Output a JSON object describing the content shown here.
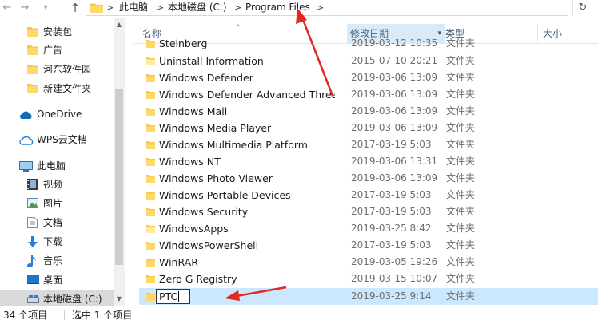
{
  "address": {
    "crumbs": [
      "此电脑",
      "本地磁盘 (C:)",
      "Program Files"
    ],
    "separators": [
      ">",
      ">",
      ">"
    ]
  },
  "nav": {
    "quick_access": [
      {
        "label": "安装包"
      },
      {
        "label": "广告"
      },
      {
        "label": "河东软件园"
      },
      {
        "label": "新建文件夹"
      }
    ],
    "onedrive": "OneDrive",
    "wps": "WPS云文档",
    "this_pc": "此电脑",
    "pc_items": [
      {
        "label": "视频",
        "icon": "video-icon"
      },
      {
        "label": "图片",
        "icon": "pictures-icon"
      },
      {
        "label": "文档",
        "icon": "documents-icon"
      },
      {
        "label": "下载",
        "icon": "download-icon"
      },
      {
        "label": "音乐",
        "icon": "music-icon"
      },
      {
        "label": "桌面",
        "icon": "desktop-icon"
      },
      {
        "label": "本地磁盘 (C:)",
        "icon": "drive-icon"
      }
    ]
  },
  "columns": {
    "name": "名称",
    "date": "修改日期",
    "type": "类型",
    "size": "大小"
  },
  "files": [
    {
      "name": "Steinberg",
      "date": "2019-03-12 10:35",
      "type": "文件夹"
    },
    {
      "name": "Uninstall Information",
      "date": "2015-07-10 20:21",
      "type": "文件夹"
    },
    {
      "name": "Windows Defender",
      "date": "2019-03-06 13:09",
      "type": "文件夹"
    },
    {
      "name": "Windows Defender Advanced Threat...",
      "date": "2019-03-06 13:09",
      "type": "文件夹"
    },
    {
      "name": "Windows Mail",
      "date": "2019-03-06 13:09",
      "type": "文件夹"
    },
    {
      "name": "Windows Media Player",
      "date": "2019-03-06 13:09",
      "type": "文件夹"
    },
    {
      "name": "Windows Multimedia Platform",
      "date": "2017-03-19 5:03",
      "type": "文件夹"
    },
    {
      "name": "Windows NT",
      "date": "2019-03-06 13:31",
      "type": "文件夹"
    },
    {
      "name": "Windows Photo Viewer",
      "date": "2019-03-06 13:09",
      "type": "文件夹"
    },
    {
      "name": "Windows Portable Devices",
      "date": "2017-03-19 5:03",
      "type": "文件夹"
    },
    {
      "name": "Windows Security",
      "date": "2017-03-19 5:03",
      "type": "文件夹"
    },
    {
      "name": "WindowsApps",
      "date": "2019-03-25 8:42",
      "type": "文件夹"
    },
    {
      "name": "WindowsPowerShell",
      "date": "2017-03-19 5:03",
      "type": "文件夹"
    },
    {
      "name": "WinRAR",
      "date": "2019-03-05 19:26",
      "type": "文件夹"
    },
    {
      "name": "Zero G Registry",
      "date": "2019-03-15 10:07",
      "type": "文件夹"
    }
  ],
  "renaming": {
    "value": "PTC",
    "date": "2019-03-25 9:14",
    "type": "文件夹"
  },
  "status": {
    "count": "34 个项目",
    "selected": "选中 1 个项目"
  },
  "colors": {
    "annotation_arrow": "#e02a1e",
    "selection": "#cce8ff",
    "folder": "#f5c94a"
  }
}
